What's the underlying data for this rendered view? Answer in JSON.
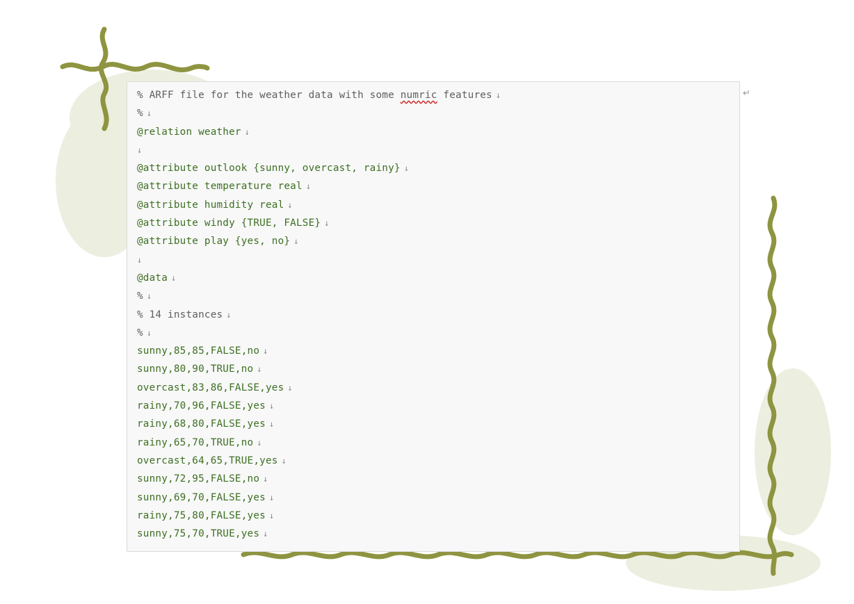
{
  "document": {
    "lines": [
      {
        "text": "% ARFF file for the weather data with some ",
        "flag": "numric",
        "tail": " features",
        "kind": "comment"
      },
      {
        "text": "%",
        "kind": "comment"
      },
      {
        "text": "@relation weather",
        "kind": "code"
      },
      {
        "text": "",
        "kind": "code"
      },
      {
        "text": "@attribute outlook {sunny, overcast, rainy}",
        "kind": "code"
      },
      {
        "text": "@attribute temperature real",
        "kind": "code"
      },
      {
        "text": "@attribute humidity real",
        "kind": "code"
      },
      {
        "text": "@attribute windy {TRUE, FALSE}",
        "kind": "code"
      },
      {
        "text": "@attribute play {yes, no}",
        "kind": "code"
      },
      {
        "text": "",
        "kind": "code"
      },
      {
        "text": "@data",
        "kind": "code"
      },
      {
        "text": "%",
        "kind": "comment"
      },
      {
        "text": "% 14 instances",
        "kind": "comment"
      },
      {
        "text": "%",
        "kind": "comment"
      },
      {
        "text": "sunny,85,85,FALSE,no",
        "kind": "code"
      },
      {
        "text": "sunny,80,90,TRUE,no",
        "kind": "code"
      },
      {
        "text": "overcast,83,86,FALSE,yes",
        "kind": "code"
      },
      {
        "text": "rainy,70,96,FALSE,yes",
        "kind": "code"
      },
      {
        "text": "rainy,68,80,FALSE,yes",
        "kind": "code"
      },
      {
        "text": "rainy,65,70,TRUE,no",
        "kind": "code"
      },
      {
        "text": "overcast,64,65,TRUE,yes",
        "kind": "code"
      },
      {
        "text": "sunny,72,95,FALSE,no",
        "kind": "code"
      },
      {
        "text": "sunny,69,70,FALSE,yes",
        "kind": "code"
      },
      {
        "text": "rainy,75,80,FALSE,yes",
        "kind": "code"
      },
      {
        "text": "sunny,75,70,TRUE,yes",
        "kind": "code"
      }
    ],
    "paragraph_mark": "↓",
    "return_mark": "↵"
  },
  "colors": {
    "code_text": "#3d6f22",
    "comment_text": "#5e5e5e",
    "vine": "#8b8f3a",
    "leaf_tint": "#e6ead3"
  },
  "icons": {
    "paragraph": "down-arrow-mark-icon",
    "return": "return-arrow-icon"
  }
}
